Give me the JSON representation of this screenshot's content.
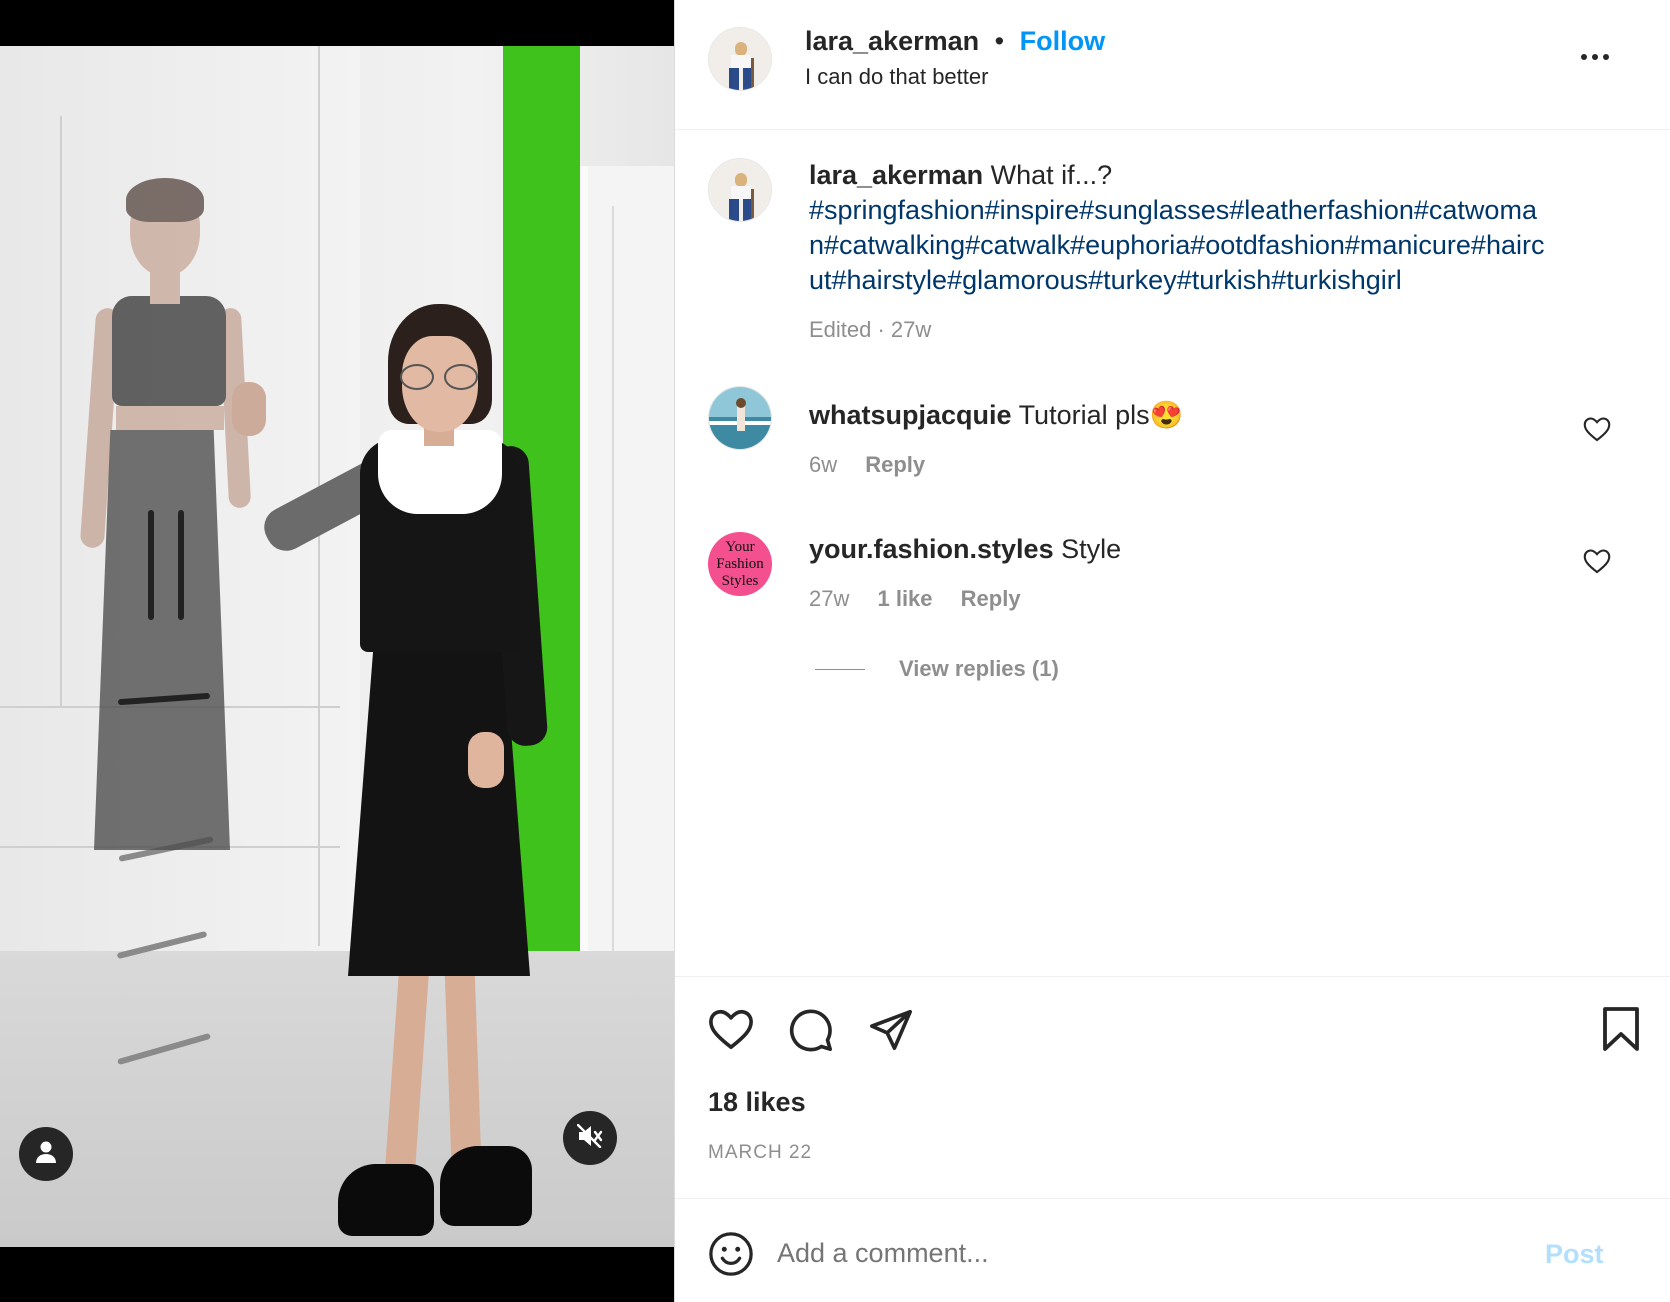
{
  "post": {
    "author": "lara_akerman",
    "follow_label": "Follow",
    "audio_title": "I can do that better",
    "more_label": "...",
    "caption_text": "What if...?",
    "caption_tags_line1": "#springfashion#inspire#sunglasses#leatherfashion#catwoma",
    "caption_tags_line2": "n#catwalking#catwalk#euphoria#ootdfashion#manicure#hairc",
    "caption_tags_line3": "ut#hairstyle#glamorous#turkey#turkish#turkishgirl",
    "caption_meta": "Edited · 27w",
    "likes": "18 likes",
    "date": "MARCH 22"
  },
  "comments": [
    {
      "user": "whatsupjacquie",
      "text": "Tutorial pls",
      "emoji": "😍",
      "time": "6w",
      "reply_label": "Reply"
    },
    {
      "user": "your.fashion.styles",
      "text": "Style",
      "time": "27w",
      "likes": "1 like",
      "reply_label": "Reply",
      "view_replies": "View replies (1)",
      "avatar_text": [
        "Your",
        "Fashion",
        "Styles"
      ]
    }
  ],
  "composer": {
    "placeholder": "Add a comment...",
    "post_label": "Post"
  },
  "colors": {
    "accent": "#0095f6",
    "hashtag": "#00376b",
    "muted": "#8e8e8e",
    "post_disabled": "#b2dffc",
    "avatar_pink": "#f4508f"
  },
  "icons": {
    "like": "heart-icon",
    "comment": "comment-bubble-icon",
    "share": "paper-plane-icon",
    "save": "bookmark-icon",
    "emoji": "smiley-icon",
    "user_tag": "user-icon",
    "mute": "speaker-muted-icon"
  }
}
